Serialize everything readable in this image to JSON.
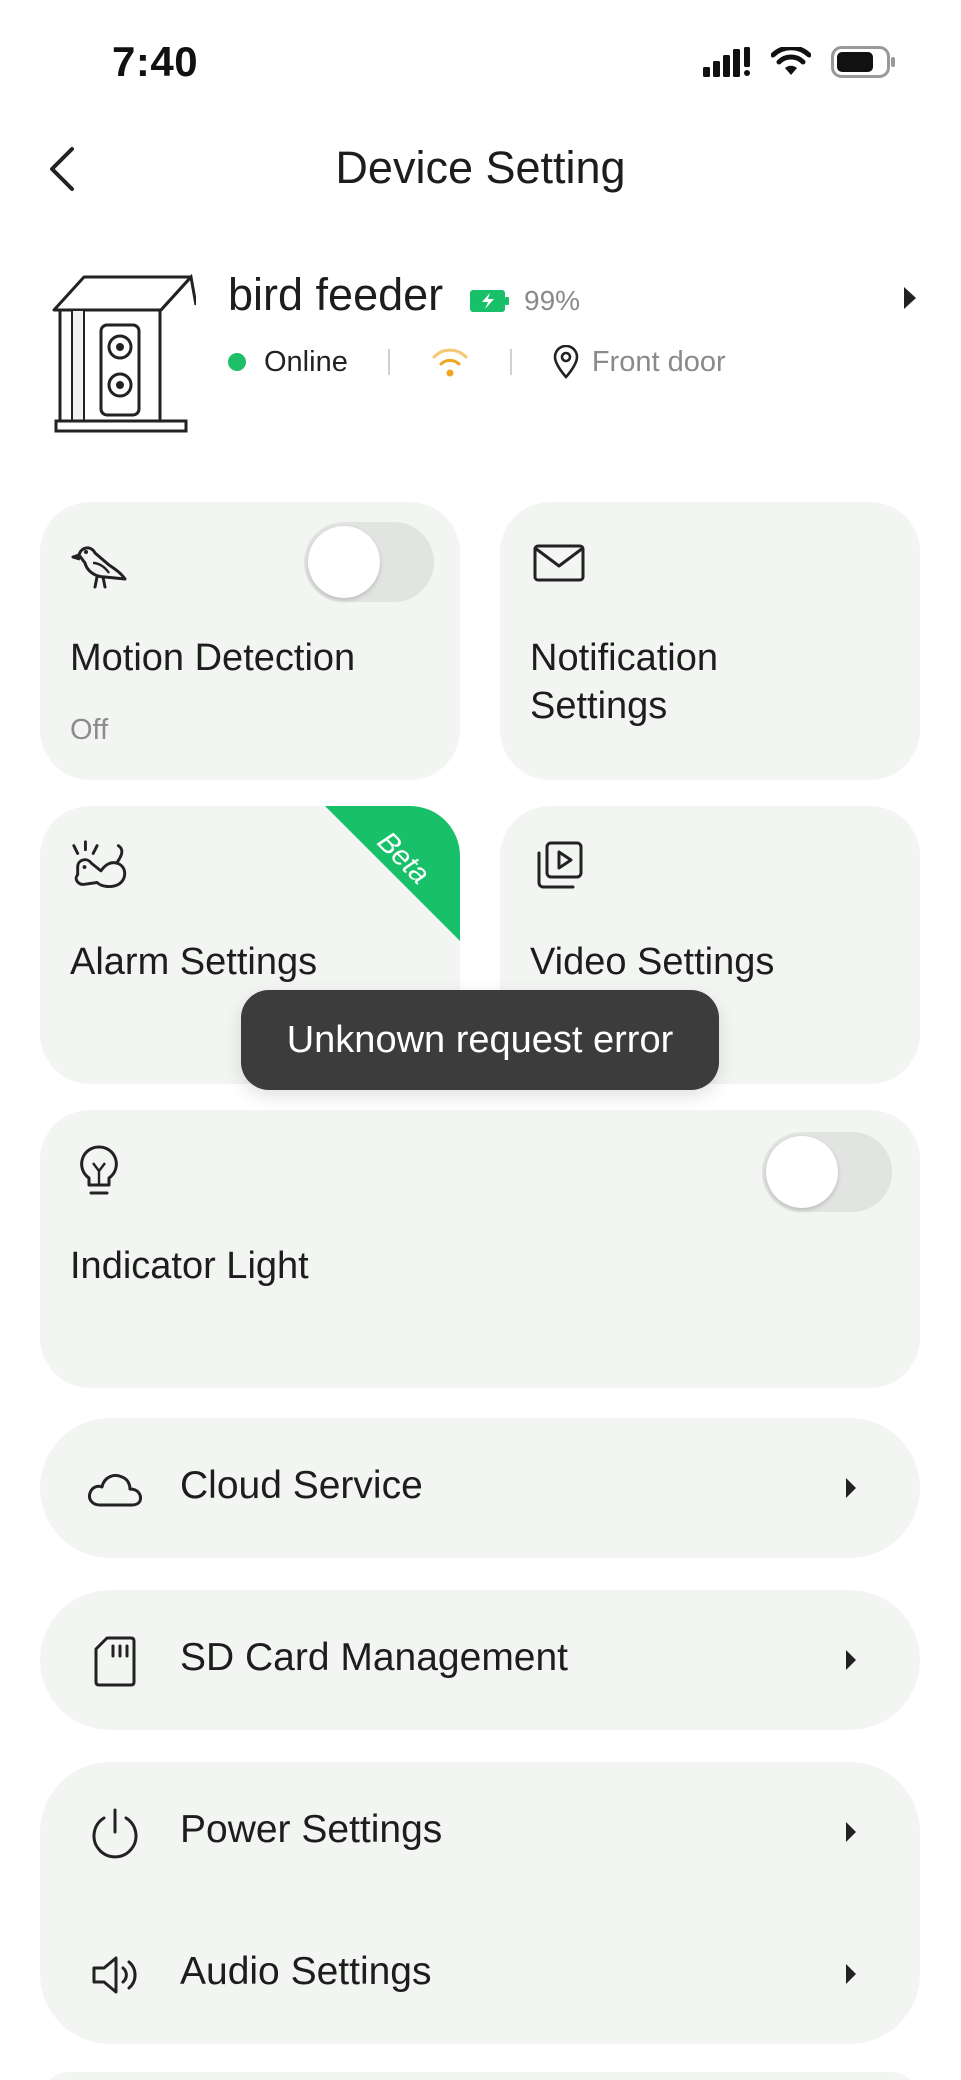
{
  "status_bar": {
    "time": "7:40"
  },
  "nav": {
    "title": "Device Setting"
  },
  "device": {
    "name": "bird feeder",
    "battery_percent": "99%",
    "status": "Online",
    "location": "Front door",
    "status_color": "#1fbf6a",
    "wifi_color": "#f0a51e"
  },
  "tiles": {
    "motion": {
      "title": "Motion Detection",
      "sub": "Off",
      "toggle": false
    },
    "notification": {
      "title_line1": "Notification",
      "title_line2": "Settings"
    },
    "alarm": {
      "title": "Alarm Settings",
      "badge": "Beta"
    },
    "video": {
      "title": "Video Settings"
    },
    "indicator": {
      "title": "Indicator Light",
      "toggle": false
    }
  },
  "rows": {
    "cloud": {
      "label": "Cloud Service",
      "icon": "cloud-icon"
    },
    "sd": {
      "label": "SD Card Management",
      "icon": "sd-card-icon"
    },
    "power": {
      "label": "Power Settings",
      "icon": "power-icon"
    },
    "audio": {
      "label": "Audio Settings",
      "icon": "speaker-icon"
    }
  },
  "toast": {
    "message": "Unknown request error"
  },
  "accent_color": "#18c06a"
}
